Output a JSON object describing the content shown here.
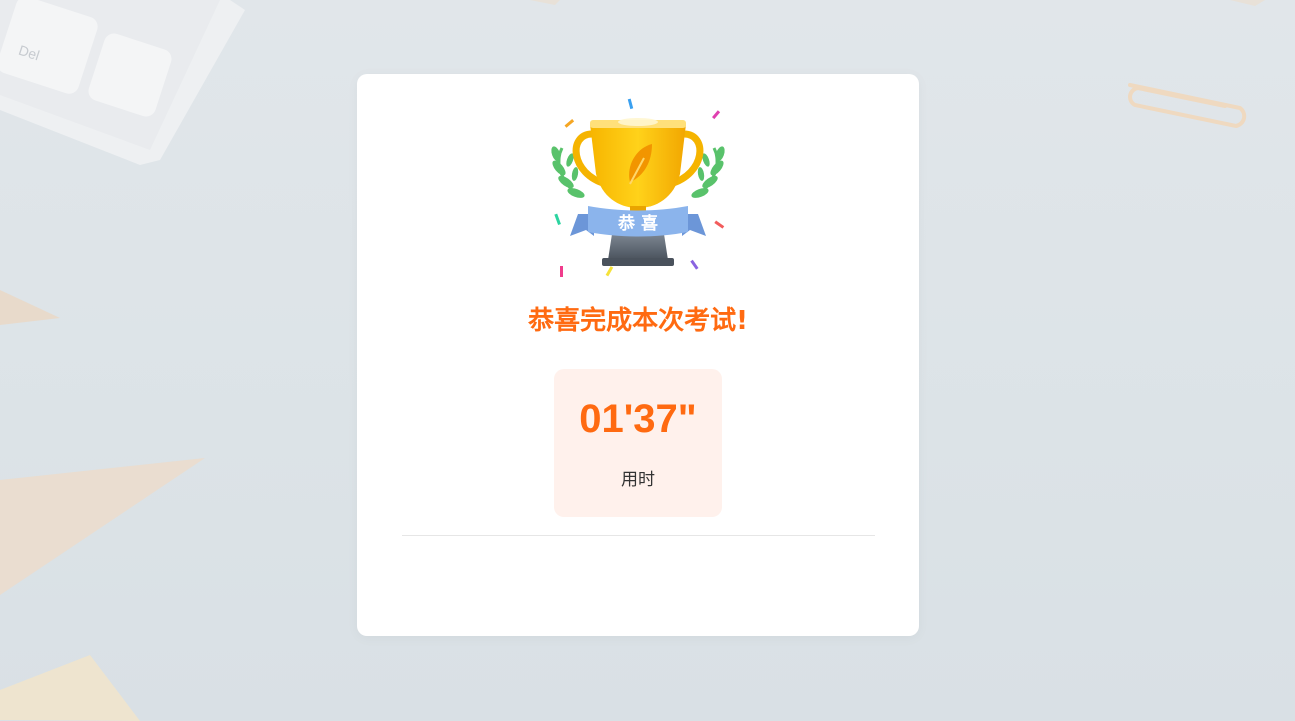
{
  "result": {
    "title": "恭喜完成本次考试!",
    "trophy_ribbon_text": "恭 喜",
    "time_value": "01'37\"",
    "time_label": "用时"
  },
  "background": {
    "keyboard_key_label": "Del"
  },
  "colors": {
    "accent": "#ff6a11",
    "stat_bg": "#fff1ec",
    "card_bg": "#ffffff",
    "page_bg": "#dfe5e9"
  },
  "icons": {
    "trophy": "trophy-icon"
  }
}
